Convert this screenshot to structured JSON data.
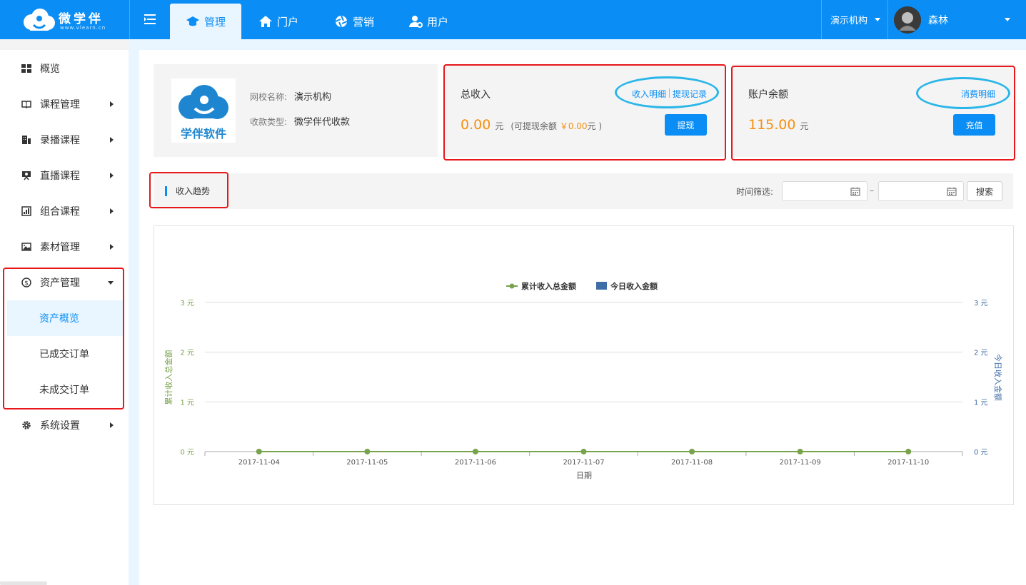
{
  "header": {
    "brand": "微学伴",
    "brand_url": "www.vlearn.cn",
    "tabs": [
      {
        "label": "管理",
        "icon": "graduation-cap-icon",
        "active": true
      },
      {
        "label": "门户",
        "icon": "home-icon",
        "active": false
      },
      {
        "label": "营销",
        "icon": "aperture-icon",
        "active": false
      },
      {
        "label": "用户",
        "icon": "user-settings-icon",
        "active": false
      }
    ],
    "org": "演示机构",
    "user_name": "森林",
    "colors": {
      "primary": "#0a8ef5",
      "accent": "#f58f0f",
      "highlight": "#e8171c",
      "annotation": "#2ab6e9"
    }
  },
  "sidebar": {
    "items": [
      {
        "label": "概览",
        "icon": "grid-icon"
      },
      {
        "label": "课程管理",
        "icon": "book-icon"
      },
      {
        "label": "录播课程",
        "icon": "building-icon"
      },
      {
        "label": "直播课程",
        "icon": "presentation-icon"
      },
      {
        "label": "组合课程",
        "icon": "bar-chart-icon"
      },
      {
        "label": "素材管理",
        "icon": "image-icon"
      },
      {
        "label": "资产管理",
        "icon": "dollar-icon"
      },
      {
        "label": "系统设置",
        "icon": "gear-icon"
      }
    ],
    "subitems": [
      {
        "label": "资产概览",
        "active": true
      },
      {
        "label": "已成交订单",
        "active": false
      },
      {
        "label": "未成交订单",
        "active": false
      }
    ]
  },
  "school": {
    "logo_text": "学伴软件",
    "name_label": "网校名称:",
    "name_value": "演示机构",
    "type_label": "收款类型:",
    "type_value": "微学伴代收款"
  },
  "income": {
    "title": "总收入",
    "link_detail": "收入明细",
    "link_withdraw": "提现记录",
    "amount": "0.00",
    "unit": "元",
    "note_prefix": "(可提现余额",
    "note_amount": "￥0.00",
    "note_suffix": "元 )",
    "button": "提现"
  },
  "balance": {
    "title": "账户余额",
    "link": "消费明细",
    "amount": "115.00",
    "unit": "元",
    "button": "充值"
  },
  "filter": {
    "trend_title": "收入趋势",
    "time_label": "时间筛选:",
    "start_value": "",
    "end_value": "",
    "separator": "–",
    "search": "搜索"
  },
  "chart_data": {
    "type": "line",
    "x": [
      "2017-11-04",
      "2017-11-05",
      "2017-11-06",
      "2017-11-07",
      "2017-11-08",
      "2017-11-09",
      "2017-11-10"
    ],
    "series": [
      {
        "name": "累计收入总金额",
        "type": "line",
        "color": "#77a34a",
        "axis": "left",
        "values": [
          0,
          0,
          0,
          0,
          0,
          0,
          0
        ]
      },
      {
        "name": "今日收入金额",
        "type": "bar",
        "color": "#3f6ea7",
        "axis": "right",
        "values": [
          0,
          0,
          0,
          0,
          0,
          0,
          0
        ]
      }
    ],
    "xlabel": "日期",
    "ylabel_left": "累计收入总金额",
    "ylabel_right": "今日收入金额",
    "yticks": [
      "0 元",
      "1 元",
      "2 元",
      "3 元"
    ],
    "ylim": [
      0,
      3
    ],
    "grid": true,
    "legend": "top-center"
  }
}
